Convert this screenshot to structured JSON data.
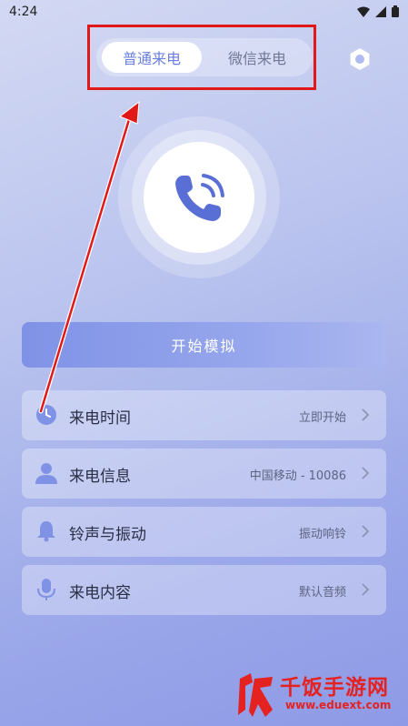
{
  "status_bar": {
    "time": "4:24"
  },
  "tabs": [
    {
      "label": "普通来电",
      "active": true
    },
    {
      "label": "微信来电",
      "active": false
    }
  ],
  "start_button": {
    "label": "开始模拟"
  },
  "settings": [
    {
      "label": "来电时间",
      "value": "立即开始",
      "icon": "clock-icon"
    },
    {
      "label": "来电信息",
      "value": "中国移动 - 10086",
      "icon": "person-icon"
    },
    {
      "label": "铃声与振动",
      "value": "振动响铃",
      "icon": "bell-icon"
    },
    {
      "label": "来电内容",
      "value": "默认音频",
      "icon": "microphone-icon"
    }
  ],
  "watermark": {
    "title": "千饭手游网",
    "url": "www.eduext.com"
  },
  "colors": {
    "accent": "#6a7fdc",
    "annotation": "#e01818"
  }
}
